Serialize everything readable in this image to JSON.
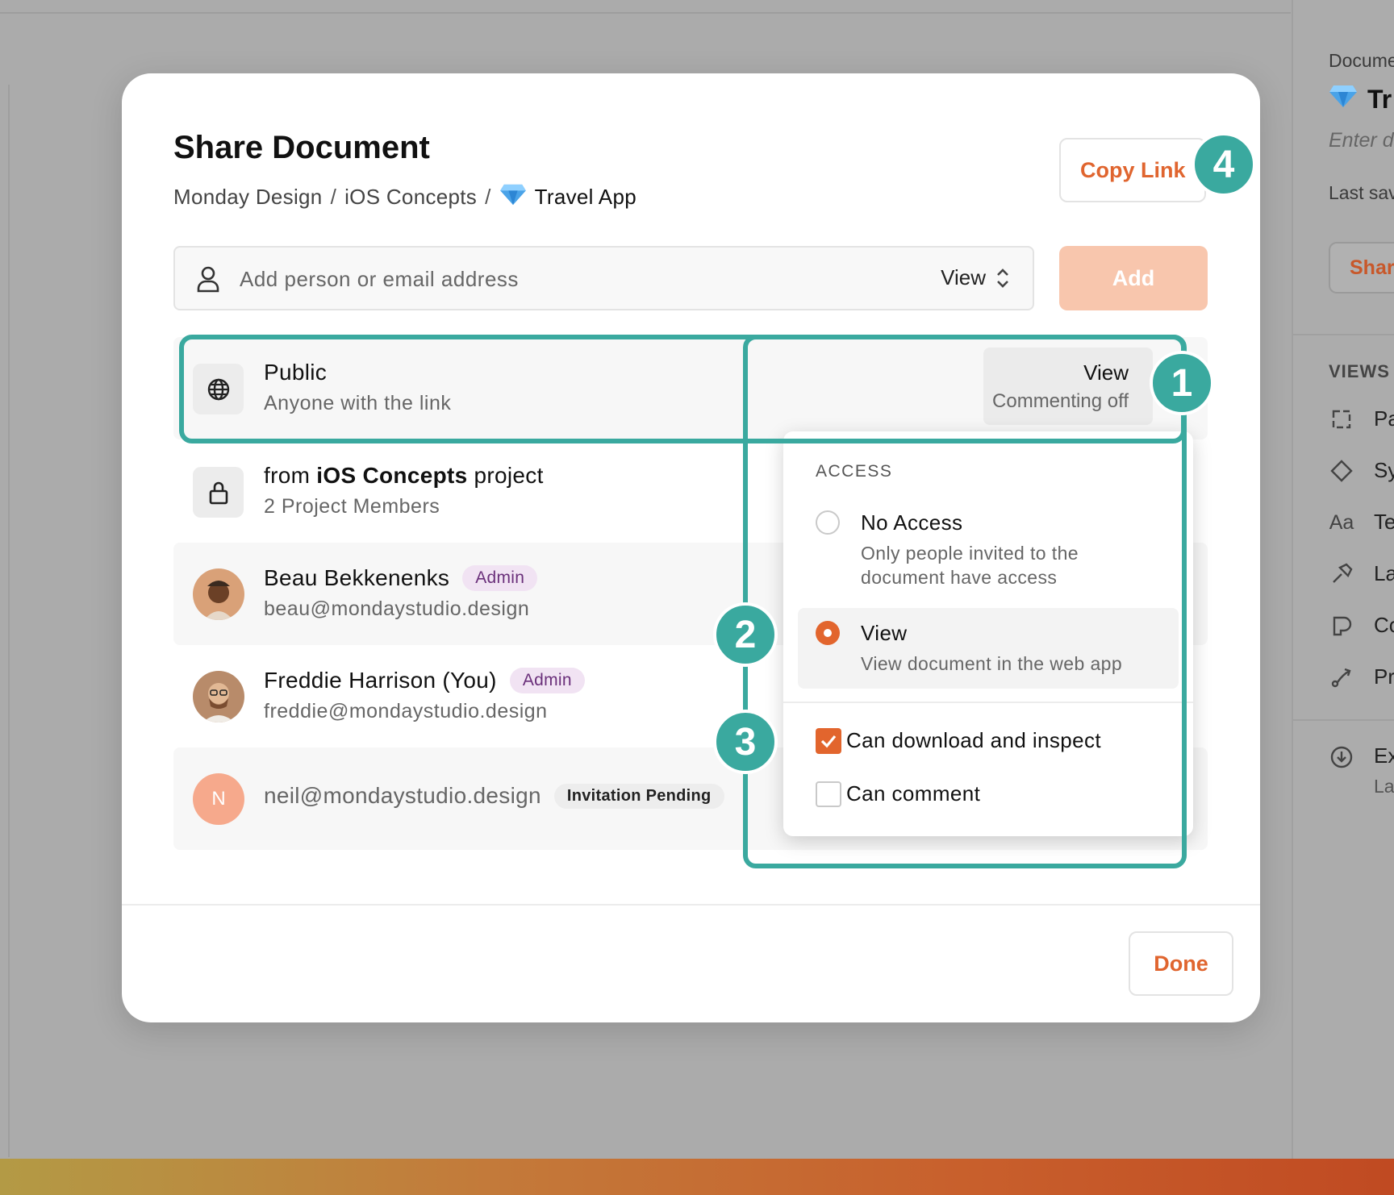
{
  "background": {
    "right_panel": {
      "doc_label": "Docume",
      "doc_title": "Tr",
      "description_placeholder": "Enter d",
      "last_saved": "Last sav",
      "share_label": "Shar",
      "views_heading": "VIEWS",
      "items": [
        {
          "icon": "page-icon",
          "label": "Pa"
        },
        {
          "icon": "diamond-icon",
          "label": "Sy"
        },
        {
          "icon": "text-icon",
          "glyph": "Aa",
          "label": "Te"
        },
        {
          "icon": "hammer-icon",
          "label": "La"
        },
        {
          "icon": "components-icon",
          "label": "Co"
        },
        {
          "icon": "prototype-icon",
          "label": "Pr"
        },
        {
          "icon": "export-icon",
          "label": "Ex",
          "sub": "La"
        }
      ]
    }
  },
  "modal": {
    "title": "Share Document",
    "breadcrumb": {
      "parts": [
        "Monday Design",
        "iOS Concepts"
      ],
      "separator": "/",
      "current": "Travel App"
    },
    "copy_link_label": "Copy Link",
    "add_input": {
      "placeholder": "Add person or email address",
      "role": "View"
    },
    "add_button_label": "Add",
    "rows": [
      {
        "type": "public",
        "title": "Public",
        "subtitle": "Anyone with the link",
        "access": "View",
        "access_sub": "Commenting off"
      },
      {
        "type": "project",
        "title_prefix": "from ",
        "title_bold": "iOS Concepts",
        "title_suffix": " project",
        "subtitle": "2 Project Members"
      },
      {
        "type": "user",
        "name": "Beau Bekkenenks",
        "badge": "Admin",
        "email": "beau@mondaystudio.design"
      },
      {
        "type": "user",
        "name": "Freddie Harrison (You)",
        "badge": "Admin",
        "email": "freddie@mondaystudio.design"
      },
      {
        "type": "invite",
        "initial": "N",
        "email": "neil@mondaystudio.design",
        "badge": "Invitation Pending"
      }
    ],
    "access_menu": {
      "heading": "ACCESS",
      "options": [
        {
          "label": "No Access",
          "desc": "Only people invited to the document have access",
          "selected": false
        },
        {
          "label": "View",
          "desc": "View document in the web app",
          "selected": true
        }
      ],
      "checks": [
        {
          "label": "Can download and inspect",
          "checked": true
        },
        {
          "label": "Can comment",
          "checked": false
        }
      ]
    },
    "done_label": "Done"
  },
  "annotations": [
    "1",
    "2",
    "3",
    "4"
  ],
  "colors": {
    "accent": "#e0652f",
    "annotation": "#3aa99f",
    "admin_badge_bg": "#f1e3f3",
    "admin_badge_text": "#6a2f7a",
    "add_button_disabled": "#f8c6ad",
    "invite_avatar": "#f6a98c"
  }
}
